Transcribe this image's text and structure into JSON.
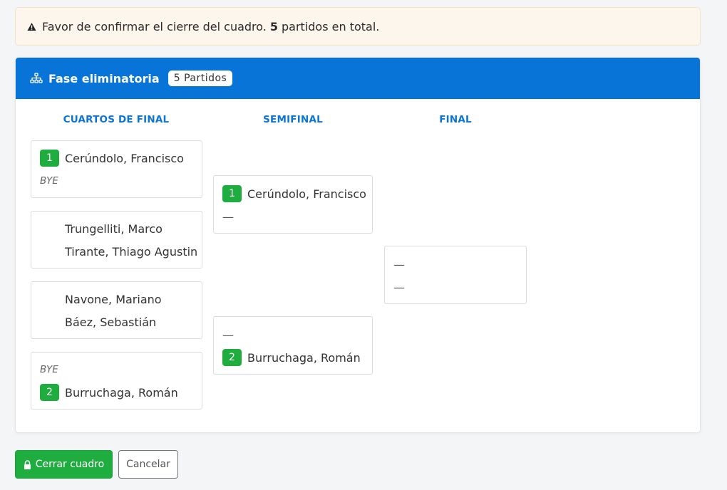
{
  "alert": {
    "icon": "warning-triangle-icon",
    "text_before": "Favor de confirmar el cierre del cuadro.",
    "count": "5",
    "text_after": "partidos en total."
  },
  "bracket": {
    "header_icon": "sitemap-icon",
    "title": "Fase eliminatoria",
    "badge": "5 Partidos",
    "rounds": [
      {
        "label": "CUARTOS DE FINAL"
      },
      {
        "label": "SEMIFINAL"
      },
      {
        "label": "FINAL"
      }
    ],
    "quarterfinals": [
      {
        "top": {
          "seed": "1",
          "name": "Cerúndolo, Francisco"
        },
        "bottom": {
          "bye": "BYE"
        }
      },
      {
        "top": {
          "name": "Trungelliti, Marco"
        },
        "bottom": {
          "name": "Tirante, Thiago Agustin"
        }
      },
      {
        "top": {
          "name": "Navone, Mariano"
        },
        "bottom": {
          "name": "Báez, Sebastián"
        }
      },
      {
        "top": {
          "bye": "BYE"
        },
        "bottom": {
          "seed": "2",
          "name": "Burruchaga, Román"
        }
      }
    ],
    "semifinals": [
      {
        "top": {
          "seed": "1",
          "name": "Cerúndolo, Francisco"
        },
        "bottom": {
          "placeholder": "—"
        }
      },
      {
        "top": {
          "placeholder": "—"
        },
        "bottom": {
          "seed": "2",
          "name": "Burruchaga, Román"
        }
      }
    ],
    "final": [
      {
        "top": {
          "placeholder": "—"
        },
        "bottom": {
          "placeholder": "—"
        }
      }
    ]
  },
  "actions": {
    "close_label": "Cerrar cuadro",
    "close_icon": "lock-icon",
    "cancel_label": "Cancelar"
  },
  "colors": {
    "header_blue": "#0874d8",
    "round_label_blue": "#0c74d4",
    "seed_green": "#1fad3f",
    "alert_bg": "#fdf6ec"
  }
}
